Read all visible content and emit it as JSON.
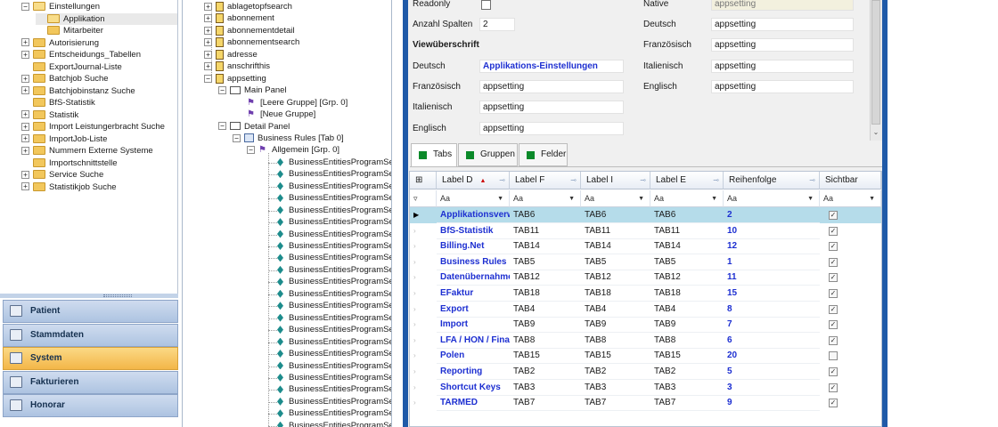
{
  "left_tree": {
    "items": [
      {
        "label": "Einstellungen",
        "exp": "−",
        "indent": 0
      },
      {
        "label": "Applikation",
        "exp": "",
        "indent": 1
      },
      {
        "label": "Mitarbeiter",
        "exp": "",
        "indent": 1
      },
      {
        "label": "Autorisierung",
        "exp": "+",
        "indent": 0
      },
      {
        "label": "Entscheidungs_Tabellen",
        "exp": "+",
        "indent": 0
      },
      {
        "label": "ExportJournal-Liste",
        "exp": "",
        "indent": 0
      },
      {
        "label": "Batchjob Suche",
        "exp": "+",
        "indent": 0
      },
      {
        "label": "Batchjobinstanz Suche",
        "exp": "+",
        "indent": 0
      },
      {
        "label": "BfS-Statistik",
        "exp": "",
        "indent": 0
      },
      {
        "label": "Statistik",
        "exp": "+",
        "indent": 0
      },
      {
        "label": "Import Leistungerbracht Suche",
        "exp": "+",
        "indent": 0
      },
      {
        "label": "ImportJob-Liste",
        "exp": "+",
        "indent": 0
      },
      {
        "label": "Nummern Externe Systeme",
        "exp": "+",
        "indent": 0
      },
      {
        "label": "Importschnittstelle",
        "exp": "",
        "indent": 0
      },
      {
        "label": "Service Suche",
        "exp": "+",
        "indent": 0
      },
      {
        "label": "Statistikjob Suche",
        "exp": "+",
        "indent": 0
      }
    ]
  },
  "nav_buttons": [
    {
      "label": "Patient",
      "active": false
    },
    {
      "label": "Stammdaten",
      "active": false
    },
    {
      "label": "System",
      "active": true
    },
    {
      "label": "Fakturieren",
      "active": false
    },
    {
      "label": "Honorar",
      "active": false
    }
  ],
  "mid_tree": {
    "tables": [
      "ablagetopfsearch",
      "abonnement",
      "abonnementdetail",
      "abonnementsearch",
      "adresse",
      "anschrifthis",
      "appsetting"
    ],
    "main_panel": "Main Panel",
    "groups": [
      "[Leere Gruppe] [Grp. 0]",
      "[Neue Gruppe]"
    ],
    "detail_panel": "Detail Panel",
    "tab_node": "Business Rules [Tab 0]",
    "group_node": "Allgemein [Grp. 0]",
    "field_label": "BusinessEntitiesProgramSettin",
    "field_count": 24
  },
  "form": {
    "readonly_label": "Readonly",
    "anzahl_label": "Anzahl Spalten",
    "anzahl_value": "2",
    "viewheading_label": "Viewüberschrift",
    "deutsch_label": "Deutsch",
    "deutsch_value": "Applikations-Einstellungen",
    "franz_label": "Französisch",
    "franz_value": "appsetting",
    "ital_label": "Italienisch",
    "ital_value": "appsetting",
    "engl_label": "Englisch",
    "engl_value": "appsetting",
    "r_native_label": "Native",
    "r_native_value": "appsetting",
    "r_deutsch_label": "Deutsch",
    "r_deutsch_value": "appsetting",
    "r_franz_label": "Französisch",
    "r_franz_value": "appsetting",
    "r_ital_label": "Italienisch",
    "r_ital_value": "appsetting",
    "r_engl_label": "Englisch",
    "r_engl_value": "appsetting"
  },
  "tabs": [
    {
      "label": "Tabs",
      "active": true
    },
    {
      "label": "Gruppen",
      "active": false
    },
    {
      "label": "Felder",
      "active": false
    }
  ],
  "grid": {
    "headers": [
      "Label D",
      "Label F",
      "Label I",
      "Label E",
      "Reihenfolge",
      "Sichtbar"
    ],
    "filter_text": "Aa",
    "rows": [
      {
        "d": "Applikationsverwaltung",
        "f": "TAB6",
        "i": "TAB6",
        "e": "TAB6",
        "order": "2",
        "visible": true
      },
      {
        "d": "BfS-Statistik",
        "f": "TAB11",
        "i": "TAB11",
        "e": "TAB11",
        "order": "10",
        "visible": true
      },
      {
        "d": "Billing.Net",
        "f": "TAB14",
        "i": "TAB14",
        "e": "TAB14",
        "order": "12",
        "visible": true
      },
      {
        "d": "Business Rules",
        "f": "TAB5",
        "i": "TAB5",
        "e": "TAB5",
        "order": "1",
        "visible": true
      },
      {
        "d": "Datenübernahme",
        "f": "TAB12",
        "i": "TAB12",
        "e": "TAB12",
        "order": "11",
        "visible": true
      },
      {
        "d": "EFaktur",
        "f": "TAB18",
        "i": "TAB18",
        "e": "TAB18",
        "order": "15",
        "visible": true
      },
      {
        "d": "Export",
        "f": "TAB4",
        "i": "TAB4",
        "e": "TAB4",
        "order": "8",
        "visible": true
      },
      {
        "d": "Import",
        "f": "TAB9",
        "i": "TAB9",
        "e": "TAB9",
        "order": "7",
        "visible": true
      },
      {
        "d": "LFA / HON / Finanzen",
        "f": "TAB8",
        "i": "TAB8",
        "e": "TAB8",
        "order": "6",
        "visible": true
      },
      {
        "d": "Polen",
        "f": "TAB15",
        "i": "TAB15",
        "e": "TAB15",
        "order": "20",
        "visible": false
      },
      {
        "d": "Reporting",
        "f": "TAB2",
        "i": "TAB2",
        "e": "TAB2",
        "order": "5",
        "visible": true
      },
      {
        "d": "Shortcut Keys",
        "f": "TAB3",
        "i": "TAB3",
        "e": "TAB3",
        "order": "3",
        "visible": true
      },
      {
        "d": "TARMED",
        "f": "TAB7",
        "i": "TAB7",
        "e": "TAB7",
        "order": "9",
        "visible": true
      }
    ]
  }
}
